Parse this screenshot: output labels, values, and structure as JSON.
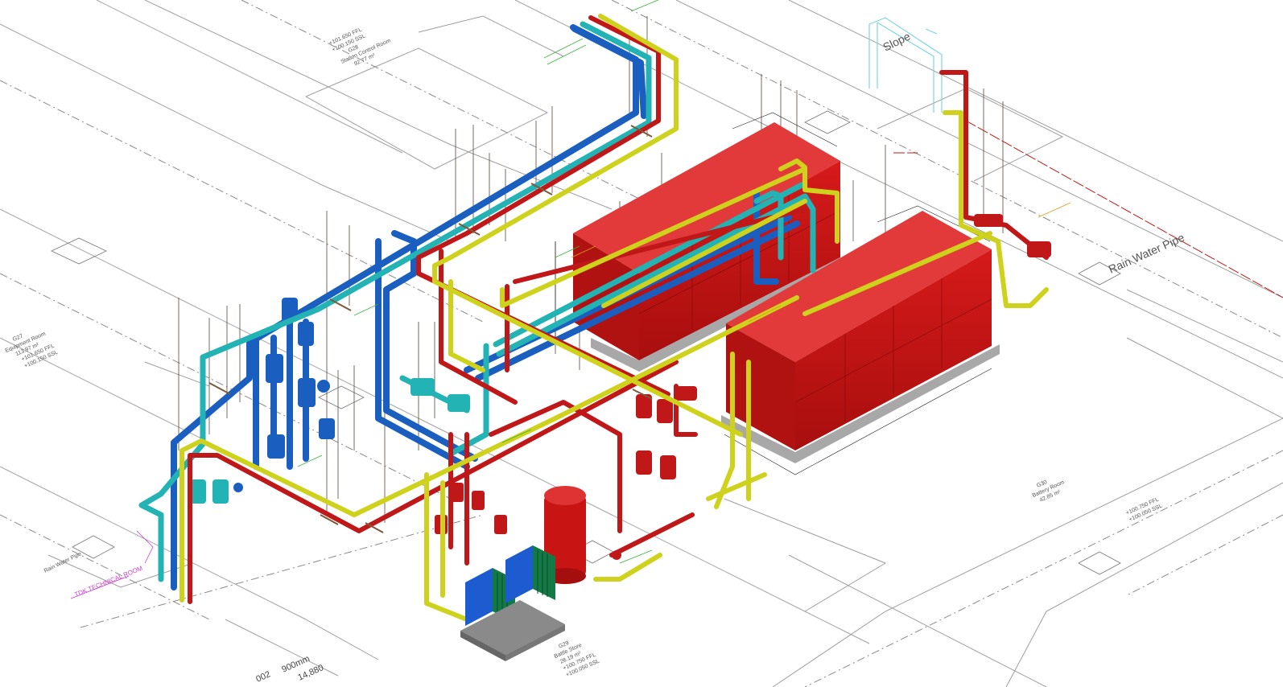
{
  "annotations": {
    "slope": "Slope",
    "rain_water_pipe_right": "Rain Water Pipe",
    "rain_water_pipe_left": "Rain Water Pipe",
    "technical_room": "TDK TECHNICAL ROOM",
    "bottom_number_a": "002",
    "bottom_number_b": "900mm",
    "bottom_number_c": "14,880"
  },
  "rooms": {
    "station_control": {
      "code": "G28",
      "name": "Station Control Room",
      "area": "92.77 m²",
      "ffl": "+101.650 FFL",
      "ssl": "+100.150 SSL"
    },
    "equipment_room_left": {
      "code": "G27",
      "name": "Equipment Room",
      "area": "113.97 m²",
      "ffl": "+101.650 FFL",
      "ssl": "+100.150 SSL"
    },
    "battery_room": {
      "code": "G30",
      "name": "Battery Room",
      "area": "42.85 m²"
    },
    "battle_store": {
      "code": "G29",
      "name": "Battle Store",
      "area": "28.19 m²",
      "ffl": "+100.750 FFL",
      "ssl": "+100.050 SSL"
    },
    "right_level": {
      "ffl": "+100.750 FFL",
      "ssl": "+100.050 SSL"
    }
  },
  "colors": {
    "red_pipe": "#c01818",
    "yellow_pipe": "#cfd21c",
    "blue_pipe": "#1763c2",
    "cyan_pipe": "#27b7b9",
    "tank": "#cc1616",
    "plate_green": "#137a46",
    "plate_blue": "#1d5bd0",
    "base_grey": "#9a9a9a"
  }
}
